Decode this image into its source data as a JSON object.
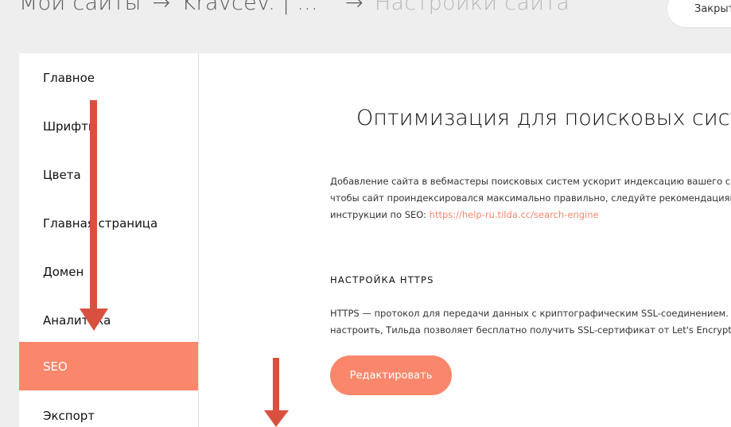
{
  "breadcrumb": {
    "items": [
      "Мои сайты",
      "Kravcev. | ..."
    ],
    "separator": "→",
    "current": "Настройки сайта"
  },
  "header": {
    "close_label": "Закрыть"
  },
  "sidebar": {
    "items": [
      {
        "label": "Главное"
      },
      {
        "label": "Шрифты"
      },
      {
        "label": "Цвета"
      },
      {
        "label": "Главная страница"
      },
      {
        "label": "Домен"
      },
      {
        "label": "Аналитика"
      },
      {
        "label": "SEO",
        "active": true
      },
      {
        "label": "Экспорт"
      }
    ]
  },
  "main": {
    "title": "Оптимизация для поисковых систем (SEO)",
    "intro_lines": [
      "Добавление сайта в вебмастеры поисковых систем ускорит индексацию вашего сайта.",
      "чтобы сайт проиндексировался максимально правильно, следуйте рекомендациям из"
    ],
    "intro_link_prefix": "инструкции по SEO: ",
    "intro_link": "https://help-ru.tilda.cc/search-engine",
    "https_heading": "НАСТРОЙКА HTTPS",
    "https_lines": [
      "HTTPS — протокол для передачи данных с криптографическим SSL-соединением. Чтобы",
      "настроить, Тильда позволяет бесплатно получить SSL-сертификат от Let's Encrypt."
    ],
    "edit_button": "Редактировать"
  },
  "colors": {
    "accent": "#fa876b",
    "annotation_arrow": "#d9503f"
  }
}
